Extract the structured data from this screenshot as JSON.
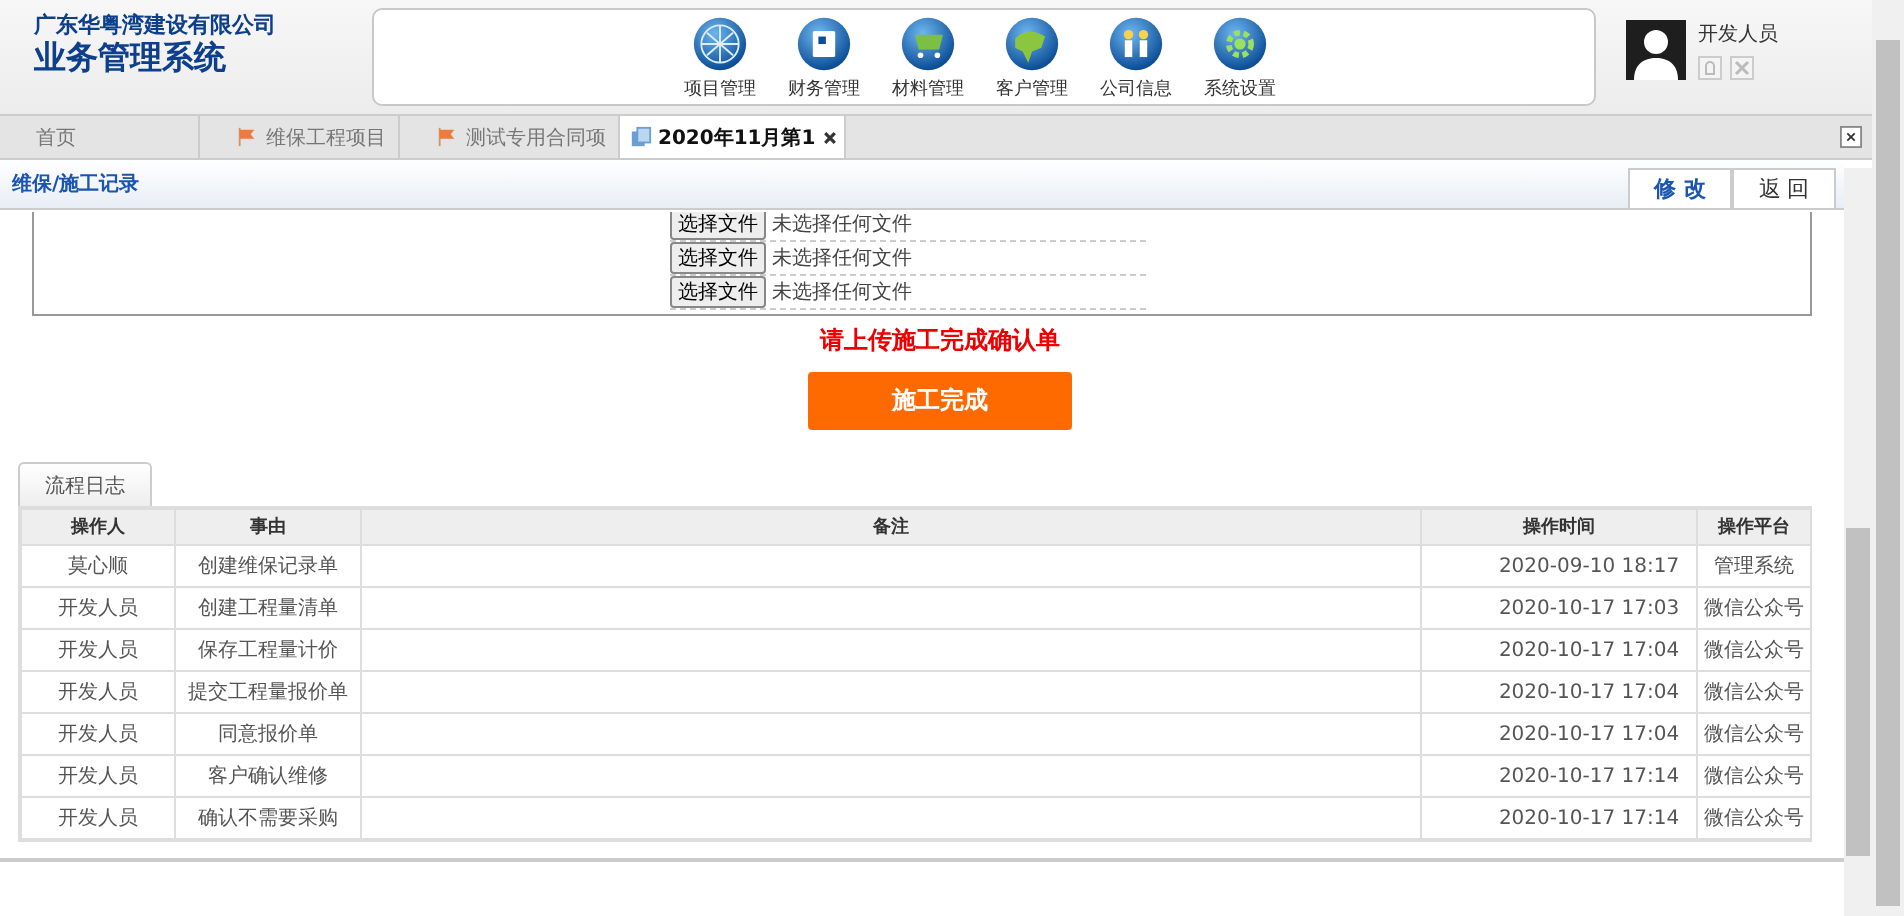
{
  "company": {
    "name": "广东华粤湾建设有限公司",
    "system": "业务管理系统"
  },
  "modules": [
    {
      "label": "项目管理",
      "kind": "globe"
    },
    {
      "label": "财务管理",
      "kind": "doc"
    },
    {
      "label": "材料管理",
      "kind": "cart"
    },
    {
      "label": "客户管理",
      "kind": "earth"
    },
    {
      "label": "公司信息",
      "kind": "people"
    },
    {
      "label": "系统设置",
      "kind": "gear"
    }
  ],
  "user": {
    "name": "开发人员"
  },
  "tabs": [
    {
      "label": "首页",
      "kind": "home",
      "selected": false
    },
    {
      "label": "维保工程项目",
      "kind": "flag",
      "selected": false
    },
    {
      "label": "测试专用合同项",
      "kind": "flag",
      "selected": false
    },
    {
      "label": "2020年11月第1",
      "kind": "doc",
      "selected": true
    }
  ],
  "page_title": "维保/施工记录",
  "actions": [
    "修 改",
    "返 回"
  ],
  "uploads": [
    {
      "button": "选择文件",
      "status": "未选择任何文件"
    },
    {
      "button": "选择文件",
      "status": "未选择任何文件"
    },
    {
      "button": "选择文件",
      "status": "未选择任何文件"
    }
  ],
  "upload_hint": "请上传施工完成确认单",
  "complete_button": "施工完成",
  "log_tab": "流程日志",
  "table": {
    "columns": [
      "操作人",
      "事由",
      "备注",
      "操作时间",
      "操作平台"
    ],
    "rows": [
      [
        "莫心顺",
        "创建维保记录单",
        "",
        "2020-09-10 18:17",
        "管理系统"
      ],
      [
        "开发人员",
        "创建工程量清单",
        "",
        "2020-10-17 17:03",
        "微信公众号"
      ],
      [
        "开发人员",
        "保存工程量计价",
        "",
        "2020-10-17 17:04",
        "微信公众号"
      ],
      [
        "开发人员",
        "提交工程量报价单",
        "",
        "2020-10-17 17:04",
        "微信公众号"
      ],
      [
        "开发人员",
        "同意报价单",
        "",
        "2020-10-17 17:04",
        "微信公众号"
      ],
      [
        "开发人员",
        "客户确认维修",
        "",
        "2020-10-17 17:14",
        "微信公众号"
      ],
      [
        "开发人员",
        "确认不需要采购",
        "",
        "2020-10-17 17:14",
        "微信公众号"
      ]
    ]
  }
}
